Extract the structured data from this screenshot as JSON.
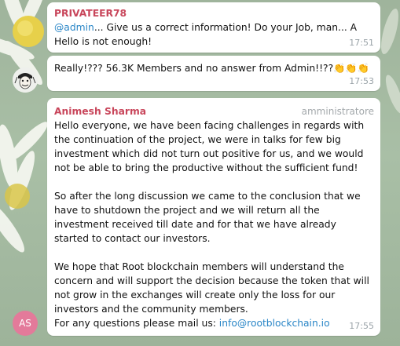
{
  "messages": [
    {
      "sender": "PRIVATEER78",
      "sender_color": "#c8455a",
      "mention": "@admin",
      "text": "... Give us a correct information! Do your Job, man... A Hello is not enough!",
      "time": "17:51"
    },
    {
      "text": "Really!??? 56.3K Members and no answer from Admin!!??👏👏👏",
      "time": "17:53",
      "avatar_icon": "masked-face-avatar-icon"
    },
    {
      "sender": "Animesh Sharma",
      "sender_color": "#c8455a",
      "role": "amministratore",
      "paragraphs": [
        "Hello everyone, we have been facing challenges in regards with the continuation of the project, we were in talks for few big investment which did not turn out positive for us, and we would not be able to bring the productive without the sufficient fund!",
        "So after the long discussion we came to the conclusion that we have to shutdown the project and we will return all the investment received till date and for that we have already started to contact our investors.",
        "We hope that Root blockchain members will understand the concern and will support the decision because the token that will not grow in the exchanges will create only the loss for our investors and the community members."
      ],
      "last_line_prefix": "For any questions please mail us: ",
      "email": "info@rootblockchain.io",
      "time": "17:55",
      "avatar_initials": "AS",
      "avatar_color": "#e37a9a"
    }
  ]
}
